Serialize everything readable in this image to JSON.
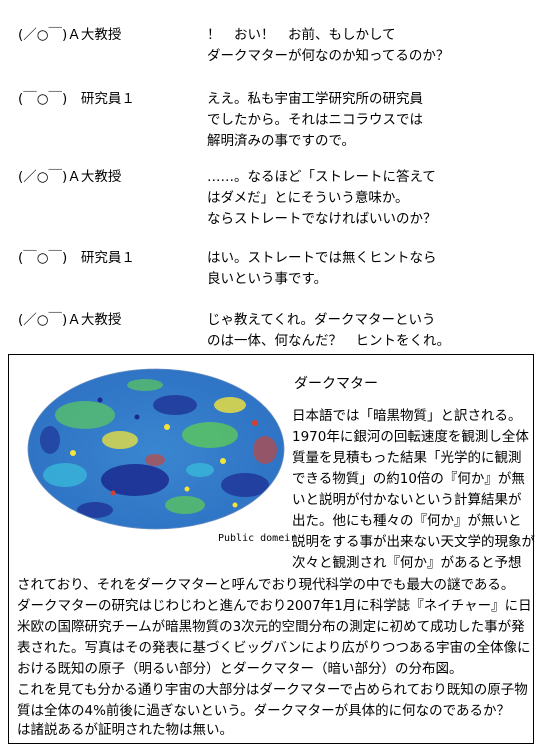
{
  "dialogue": [
    {
      "speaker": "(／○￣)Ａ大教授",
      "lines": [
        "！　おい！　お前、もしかして",
        "ダークマターが何なのか知ってるのか？"
      ]
    },
    {
      "speaker": "(￣○￣)　研究員１",
      "lines": [
        "ええ。私も宇宙工学研究所の研究員",
        "でしたから。それはニコラウスでは",
        "解明済みの事ですので。"
      ]
    },
    {
      "speaker": "(／○￣)Ａ大教授",
      "lines": [
        "……。なるほど「ストレートに答えて",
        "はダメだ」とにそういう意味か。",
        "ならストレートでなければいいのか？"
      ]
    },
    {
      "speaker": "(￣○￣)　研究員１",
      "lines": [
        "はい。ストレートでは無くヒントなら",
        "良いという事です。"
      ]
    },
    {
      "speaker": "(／○￣)Ａ大教授",
      "lines": [
        "じゃ教えてくれ。ダークマターという",
        "のは一体、何なんだ？　ヒントをくれ。"
      ]
    }
  ],
  "box": {
    "title": "ダークマター",
    "image_credit": "Public domeir",
    "side_lines": [
      "日本語では「暗黒物質」と訳される。",
      "1970年に銀河の回転速度を観測し全体",
      "質量を見積もった結果「光学的に観測",
      "できる物質」の約10倍の『何か』が無",
      "いと説明が付かないという計算結果が",
      "出た。他にも種々の『何か』が無いと",
      "説明をする事が出来ない天文学的現象が",
      "次々と観測され『何か』があると予想"
    ],
    "body_lines": [
      "されており、それをダークマターと呼んでおり現代科学の中でも最大の謎である。",
      "ダークマターの研究はじわじわと進んでおり2007年1月に科学誌『ネイチャー』に日",
      "米欧の国際研究チームが暗黒物質の3次元的空間分布の測定に初めて成功した事が発",
      "表された。写真はその発表に基づくビッグバンにより広がりつつある宇宙の全体像に",
      "おける既知の原子（明るい部分）とダークマター（暗い部分）の分布図。",
      "これを見ても分かる通り宇宙の大部分はダークマターで占められており既知の原子物",
      "質は全体の4%前後に過ぎないという。ダークマターが具体的に何なのであるか？",
      "は諸説あるが証明された物は無い。"
    ]
  },
  "colors": {
    "deep_blue": "#1b2a8f",
    "cyan": "#38b8d8",
    "green": "#5cc85a",
    "yellow": "#f2e43a",
    "red": "#d8402a"
  }
}
